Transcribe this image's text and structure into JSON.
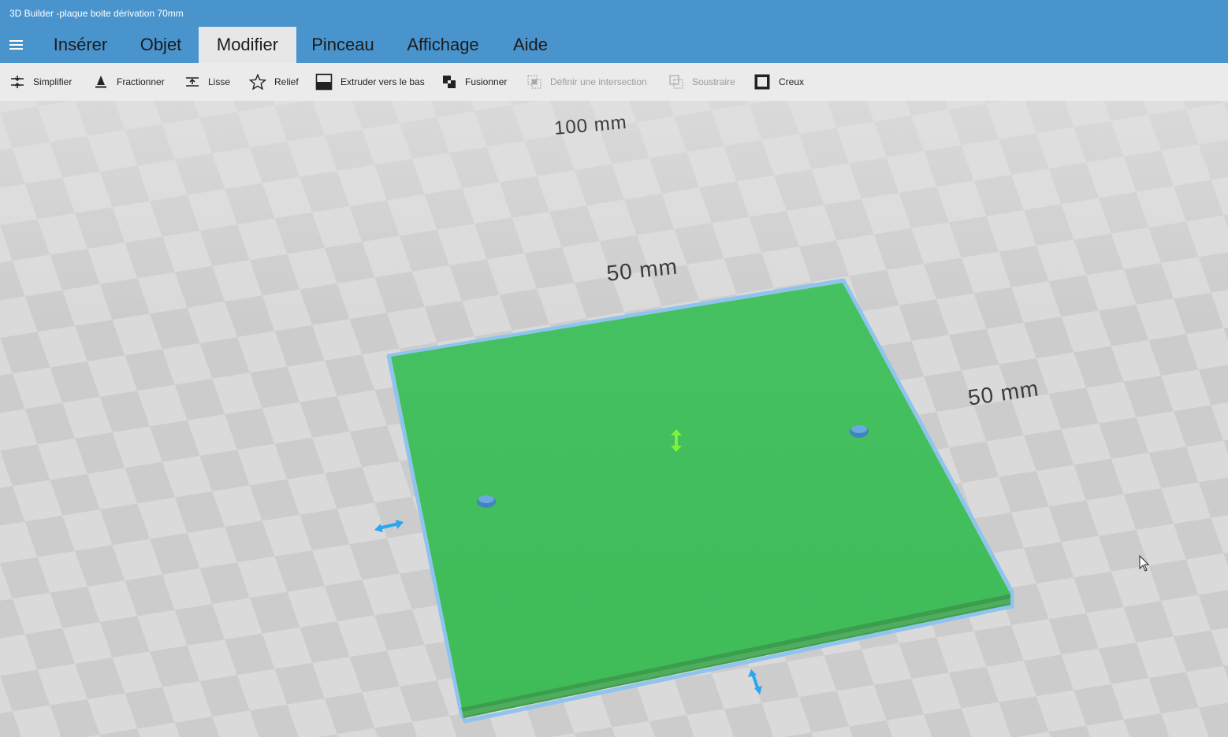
{
  "window": {
    "title": "3D Builder -plaque boite dérivation 70mm"
  },
  "menu": {
    "tabs": [
      {
        "label": "Insérer"
      },
      {
        "label": "Objet"
      },
      {
        "label": "Modifier",
        "active": true
      },
      {
        "label": "Pinceau"
      },
      {
        "label": "Affichage"
      },
      {
        "label": "Aide"
      }
    ]
  },
  "toolbar": {
    "items": [
      {
        "label": "Simplifier",
        "icon": "simplify-icon",
        "enabled": true
      },
      {
        "label": "Fractionner",
        "icon": "split-icon",
        "enabled": true
      },
      {
        "label": "Lisse",
        "icon": "smooth-icon",
        "enabled": true
      },
      {
        "label": "Relief",
        "icon": "star-icon",
        "enabled": true
      },
      {
        "label": "Extruder vers le bas",
        "icon": "extrude-down-icon",
        "enabled": true
      },
      {
        "label": "Fusionner",
        "icon": "merge-icon",
        "enabled": true
      },
      {
        "label": "Définir une intersection",
        "icon": "intersect-icon",
        "enabled": false
      },
      {
        "label": "Soustraire",
        "icon": "subtract-icon",
        "enabled": false
      },
      {
        "label": "Creux",
        "icon": "hollow-icon",
        "enabled": true
      }
    ]
  },
  "viewport": {
    "grid_label_far": "100 mm",
    "dimension_width": "50 mm",
    "dimension_depth": "50 mm"
  },
  "colors": {
    "accent": "#4a94ce",
    "object_fill": "#43be5c",
    "selection_outline": "#7ab8e8",
    "handle_blue": "#2aa6ee",
    "handle_green": "#7cf23c"
  }
}
